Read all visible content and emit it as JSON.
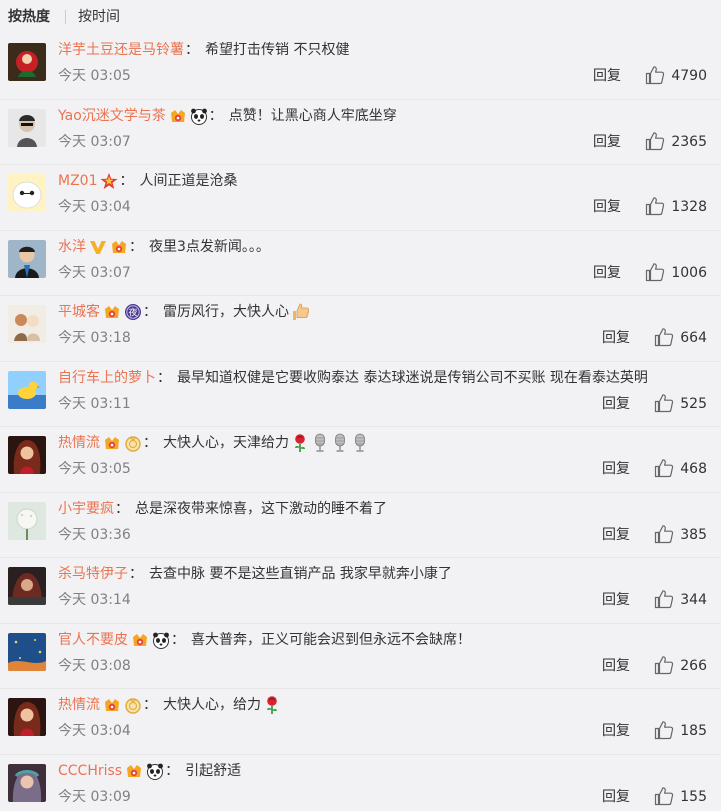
{
  "sort": {
    "hot": "按热度",
    "time": "按时间"
  },
  "reply_label": "回复",
  "colors": {
    "username": "#eb7350",
    "text": "#333333",
    "time": "#808080",
    "background": "#f2f2f5"
  },
  "comments": [
    {
      "user": "洋芋土豆还是马铃薯",
      "badges": [],
      "text": "希望打击传销  不只权健",
      "emojis": [],
      "time": "今天 03:05",
      "likes": "4790"
    },
    {
      "user": "Yao沉迷文学与茶",
      "badges": [
        "vip-badge-icon",
        "panda-icon"
      ],
      "text": "点赞！让黑心商人牢底坐穿",
      "emojis": [],
      "time": "今天 03:07",
      "likes": "2365"
    },
    {
      "user": "MZ01",
      "badges": [
        "red-star-icon"
      ],
      "text": "人间正道是沧桑",
      "emojis": [],
      "time": "今天 03:04",
      "likes": "1328"
    },
    {
      "user": "水洋",
      "badges": [
        "v-verified-icon",
        "vip-badge-icon"
      ],
      "text": "夜里3点发新闻。。。",
      "emojis": [],
      "time": "今天 03:07",
      "likes": "1006"
    },
    {
      "user": "平城客",
      "badges": [
        "vip-badge-icon",
        "night-badge-icon"
      ],
      "text": "雷厉风行，大快人心",
      "emojis": [
        "thumbs-up-icon"
      ],
      "time": "今天 03:18",
      "likes": "664"
    },
    {
      "user": "自行车上的萝卜",
      "badges": [],
      "text": "最早知道权健是它要收购泰达 泰达球迷说是传销公司不买账 现在看泰达英明",
      "emojis": [],
      "time": "今天 03:11",
      "likes": "525"
    },
    {
      "user": "热情流",
      "badges": [
        "vip-badge-icon",
        "medal-icon"
      ],
      "text": "大快人心，天津给力",
      "emojis": [
        "rose-icon",
        "microphone-icon",
        "microphone-icon",
        "microphone-icon"
      ],
      "time": "今天 03:05",
      "likes": "468"
    },
    {
      "user": "小宇要疯",
      "badges": [],
      "text": "总是深夜带来惊喜，这下激动的睡不着了",
      "emojis": [],
      "time": "今天 03:36",
      "likes": "385"
    },
    {
      "user": "杀马特伊子",
      "badges": [],
      "text": "去查中脉  要不是这些直销产品 我家早就奔小康了",
      "emojis": [],
      "time": "今天 03:14",
      "likes": "344"
    },
    {
      "user": "官人不要皮",
      "badges": [
        "vip-badge-icon",
        "panda-icon"
      ],
      "text": "喜大普奔，正义可能会迟到但永远不会缺席！",
      "emojis": [],
      "time": "今天 03:08",
      "likes": "266"
    },
    {
      "user": "热情流",
      "badges": [
        "vip-badge-icon",
        "medal-icon"
      ],
      "text": "大快人心，给力",
      "emojis": [
        "rose-icon"
      ],
      "time": "今天 03:04",
      "likes": "185"
    },
    {
      "user": "CCCHriss",
      "badges": [
        "vip-badge-icon",
        "panda-icon"
      ],
      "text": "引起舒适",
      "emojis": [],
      "time": "今天 03:09",
      "likes": "155"
    }
  ]
}
